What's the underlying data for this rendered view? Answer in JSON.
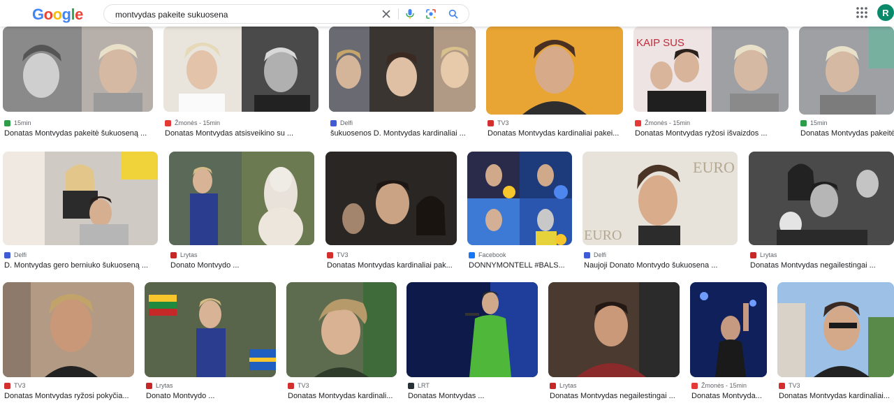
{
  "header": {
    "logo": [
      "G",
      "o",
      "o",
      "g",
      "l",
      "e"
    ],
    "logo_colors": [
      "#4285F4",
      "#EA4335",
      "#FBBC05",
      "#4285F4",
      "#34A853",
      "#EA4335"
    ],
    "query": "montvydas pakeite sukuosena",
    "avatar_letter": "R"
  },
  "results": [
    {
      "source": "15min",
      "title": "Donatas Montvydas pakeitė šukuoseną ...",
      "fav": "#2e9d49"
    },
    {
      "source": "Žmonės - 15min",
      "title": "Donatas Montvydas atsisveikino su ...",
      "fav": "#e53935"
    },
    {
      "source": "Delfi",
      "title": "šukuosenos D. Montvydas kardinaliai ...",
      "fav": "#3f5bd6"
    },
    {
      "source": "TV3",
      "title": "Donatas Montvydas kardinaliai pakei...",
      "fav": "#d32f2f"
    },
    {
      "source": "Žmonės - 15min",
      "title": "Donatas Montvydas ryžosi išvaizdos ...",
      "fav": "#e53935"
    },
    {
      "source": "15min",
      "title": "Donatas Montvydas pakeitė ...",
      "fav": "#2e9d49"
    },
    {
      "source": "Delfi",
      "title": "D. Montvydas gero berniuko šukuoseną ...",
      "fav": "#3f5bd6"
    },
    {
      "source": "Lrytas",
      "title": "Donato Montvydo ...",
      "fav": "#c62828"
    },
    {
      "source": "TV3",
      "title": "Donatas Montvydas kardinaliai pak...",
      "fav": "#d32f2f"
    },
    {
      "source": "Facebook",
      "title": "DONNYMONTELL #BALS...",
      "fav": "#1877f2"
    },
    {
      "source": "Delfi",
      "title": "Naujoji Donato Montvydo šukuosena ...",
      "fav": "#3f5bd6"
    },
    {
      "source": "Lrytas",
      "title": "Donatas Montvydas negailestingai ...",
      "fav": "#c62828"
    },
    {
      "source": "TV3",
      "title": "Donatas Montvydas ryžosi pokyčia...",
      "fav": "#d32f2f"
    },
    {
      "source": "Lrytas",
      "title": "Donato Montvydo ...",
      "fav": "#c62828"
    },
    {
      "source": "TV3",
      "title": "Donatas Montvydas kardinali...",
      "fav": "#d32f2f"
    },
    {
      "source": "LRT",
      "title": "Donatas Montvydas ...",
      "fav": "#263238"
    },
    {
      "source": "Lrytas",
      "title": "Donatas Montvydas negailestingai ...",
      "fav": "#c62828"
    },
    {
      "source": "Žmonės - 15min",
      "title": "Donatas Montvyda...",
      "fav": "#e53935"
    },
    {
      "source": "TV3",
      "title": "Donatas Montvydas kardinaliai...",
      "fav": "#d32f2f"
    }
  ]
}
